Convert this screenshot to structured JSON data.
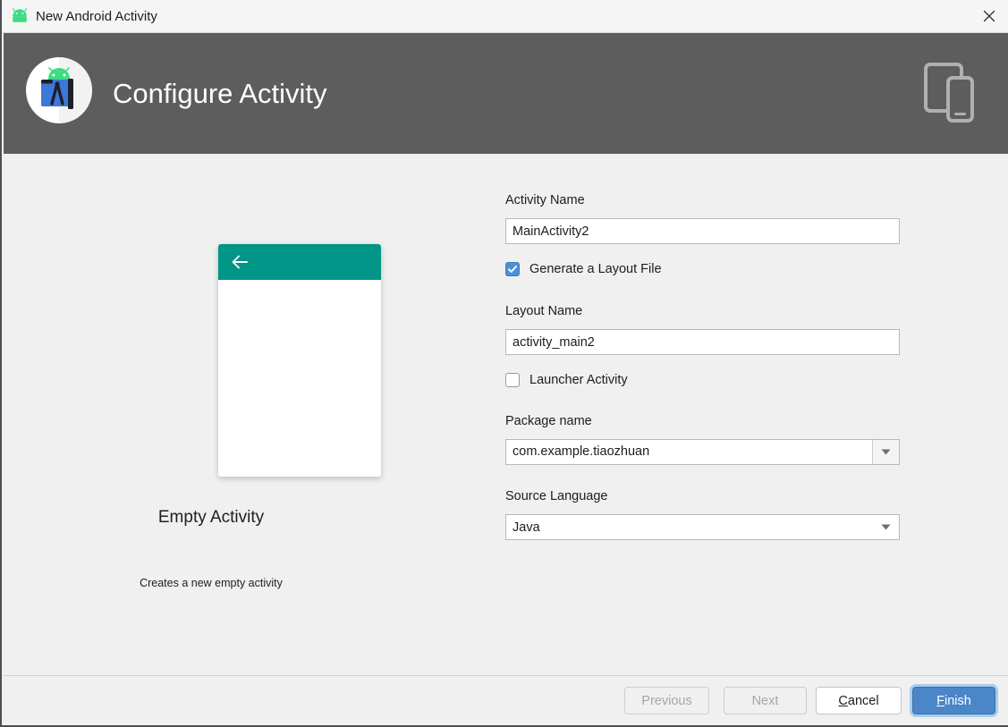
{
  "titlebar": {
    "title": "New Android Activity",
    "icon": "android-robot-icon",
    "close_icon": "close-icon"
  },
  "header": {
    "title": "Configure Activity",
    "logo_icon": "android-studio-logo-icon",
    "device_icon": "tablet-and-phone-icon",
    "background_color": "#5d5d5d"
  },
  "preview": {
    "title": "Empty Activity",
    "description": "Creates a new empty activity",
    "appbar_color": "#009587",
    "back_icon": "back-arrow-icon"
  },
  "form": {
    "activity_name": {
      "label": "Activity Name",
      "value": "MainActivity2"
    },
    "generate_layout": {
      "label": "Generate a Layout File",
      "checked": true
    },
    "layout_name": {
      "label": "Layout Name",
      "value": "activity_main2"
    },
    "launcher_activity": {
      "label": "Launcher Activity",
      "checked": false
    },
    "package_name": {
      "label": "Package name",
      "value": "com.example.tiaozhuan",
      "dropdown_icon": "chevron-down-icon"
    },
    "source_language": {
      "label": "Source Language",
      "value": "Java",
      "dropdown_icon": "chevron-down-icon"
    }
  },
  "footer": {
    "previous": {
      "label": "Previous",
      "enabled": false
    },
    "next": {
      "label": "Next",
      "enabled": false
    },
    "cancel": {
      "mnemonic": "C",
      "rest": "ancel"
    },
    "finish": {
      "mnemonic": "F",
      "rest": "inish"
    },
    "accent_color": "#4a86c8"
  }
}
